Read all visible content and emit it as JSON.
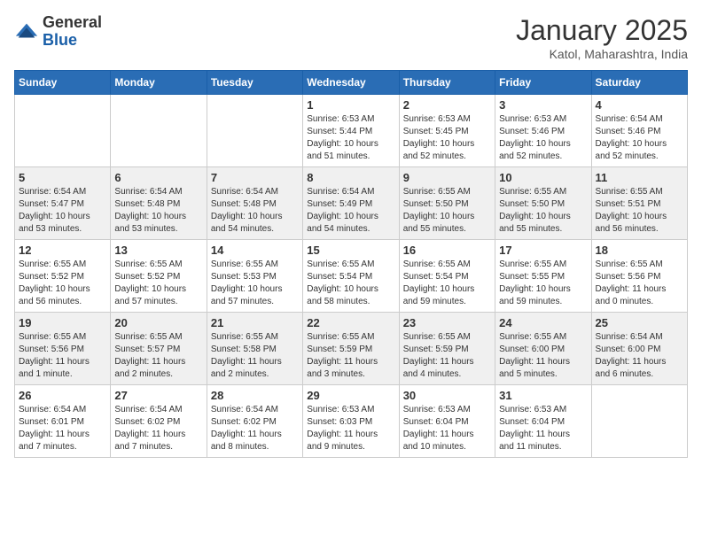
{
  "logo": {
    "general": "General",
    "blue": "Blue"
  },
  "header": {
    "month": "January 2025",
    "location": "Katol, Maharashtra, India"
  },
  "weekdays": [
    "Sunday",
    "Monday",
    "Tuesday",
    "Wednesday",
    "Thursday",
    "Friday",
    "Saturday"
  ],
  "weeks": [
    [
      {
        "day": "",
        "info": ""
      },
      {
        "day": "",
        "info": ""
      },
      {
        "day": "",
        "info": ""
      },
      {
        "day": "1",
        "info": "Sunrise: 6:53 AM\nSunset: 5:44 PM\nDaylight: 10 hours\nand 51 minutes."
      },
      {
        "day": "2",
        "info": "Sunrise: 6:53 AM\nSunset: 5:45 PM\nDaylight: 10 hours\nand 52 minutes."
      },
      {
        "day": "3",
        "info": "Sunrise: 6:53 AM\nSunset: 5:46 PM\nDaylight: 10 hours\nand 52 minutes."
      },
      {
        "day": "4",
        "info": "Sunrise: 6:54 AM\nSunset: 5:46 PM\nDaylight: 10 hours\nand 52 minutes."
      }
    ],
    [
      {
        "day": "5",
        "info": "Sunrise: 6:54 AM\nSunset: 5:47 PM\nDaylight: 10 hours\nand 53 minutes."
      },
      {
        "day": "6",
        "info": "Sunrise: 6:54 AM\nSunset: 5:48 PM\nDaylight: 10 hours\nand 53 minutes."
      },
      {
        "day": "7",
        "info": "Sunrise: 6:54 AM\nSunset: 5:48 PM\nDaylight: 10 hours\nand 54 minutes."
      },
      {
        "day": "8",
        "info": "Sunrise: 6:54 AM\nSunset: 5:49 PM\nDaylight: 10 hours\nand 54 minutes."
      },
      {
        "day": "9",
        "info": "Sunrise: 6:55 AM\nSunset: 5:50 PM\nDaylight: 10 hours\nand 55 minutes."
      },
      {
        "day": "10",
        "info": "Sunrise: 6:55 AM\nSunset: 5:50 PM\nDaylight: 10 hours\nand 55 minutes."
      },
      {
        "day": "11",
        "info": "Sunrise: 6:55 AM\nSunset: 5:51 PM\nDaylight: 10 hours\nand 56 minutes."
      }
    ],
    [
      {
        "day": "12",
        "info": "Sunrise: 6:55 AM\nSunset: 5:52 PM\nDaylight: 10 hours\nand 56 minutes."
      },
      {
        "day": "13",
        "info": "Sunrise: 6:55 AM\nSunset: 5:52 PM\nDaylight: 10 hours\nand 57 minutes."
      },
      {
        "day": "14",
        "info": "Sunrise: 6:55 AM\nSunset: 5:53 PM\nDaylight: 10 hours\nand 57 minutes."
      },
      {
        "day": "15",
        "info": "Sunrise: 6:55 AM\nSunset: 5:54 PM\nDaylight: 10 hours\nand 58 minutes."
      },
      {
        "day": "16",
        "info": "Sunrise: 6:55 AM\nSunset: 5:54 PM\nDaylight: 10 hours\nand 59 minutes."
      },
      {
        "day": "17",
        "info": "Sunrise: 6:55 AM\nSunset: 5:55 PM\nDaylight: 10 hours\nand 59 minutes."
      },
      {
        "day": "18",
        "info": "Sunrise: 6:55 AM\nSunset: 5:56 PM\nDaylight: 11 hours\nand 0 minutes."
      }
    ],
    [
      {
        "day": "19",
        "info": "Sunrise: 6:55 AM\nSunset: 5:56 PM\nDaylight: 11 hours\nand 1 minute."
      },
      {
        "day": "20",
        "info": "Sunrise: 6:55 AM\nSunset: 5:57 PM\nDaylight: 11 hours\nand 2 minutes."
      },
      {
        "day": "21",
        "info": "Sunrise: 6:55 AM\nSunset: 5:58 PM\nDaylight: 11 hours\nand 2 minutes."
      },
      {
        "day": "22",
        "info": "Sunrise: 6:55 AM\nSunset: 5:59 PM\nDaylight: 11 hours\nand 3 minutes."
      },
      {
        "day": "23",
        "info": "Sunrise: 6:55 AM\nSunset: 5:59 PM\nDaylight: 11 hours\nand 4 minutes."
      },
      {
        "day": "24",
        "info": "Sunrise: 6:55 AM\nSunset: 6:00 PM\nDaylight: 11 hours\nand 5 minutes."
      },
      {
        "day": "25",
        "info": "Sunrise: 6:54 AM\nSunset: 6:00 PM\nDaylight: 11 hours\nand 6 minutes."
      }
    ],
    [
      {
        "day": "26",
        "info": "Sunrise: 6:54 AM\nSunset: 6:01 PM\nDaylight: 11 hours\nand 7 minutes."
      },
      {
        "day": "27",
        "info": "Sunrise: 6:54 AM\nSunset: 6:02 PM\nDaylight: 11 hours\nand 7 minutes."
      },
      {
        "day": "28",
        "info": "Sunrise: 6:54 AM\nSunset: 6:02 PM\nDaylight: 11 hours\nand 8 minutes."
      },
      {
        "day": "29",
        "info": "Sunrise: 6:53 AM\nSunset: 6:03 PM\nDaylight: 11 hours\nand 9 minutes."
      },
      {
        "day": "30",
        "info": "Sunrise: 6:53 AM\nSunset: 6:04 PM\nDaylight: 11 hours\nand 10 minutes."
      },
      {
        "day": "31",
        "info": "Sunrise: 6:53 AM\nSunset: 6:04 PM\nDaylight: 11 hours\nand 11 minutes."
      },
      {
        "day": "",
        "info": ""
      }
    ]
  ],
  "rowShading": [
    false,
    true,
    false,
    true,
    false
  ]
}
